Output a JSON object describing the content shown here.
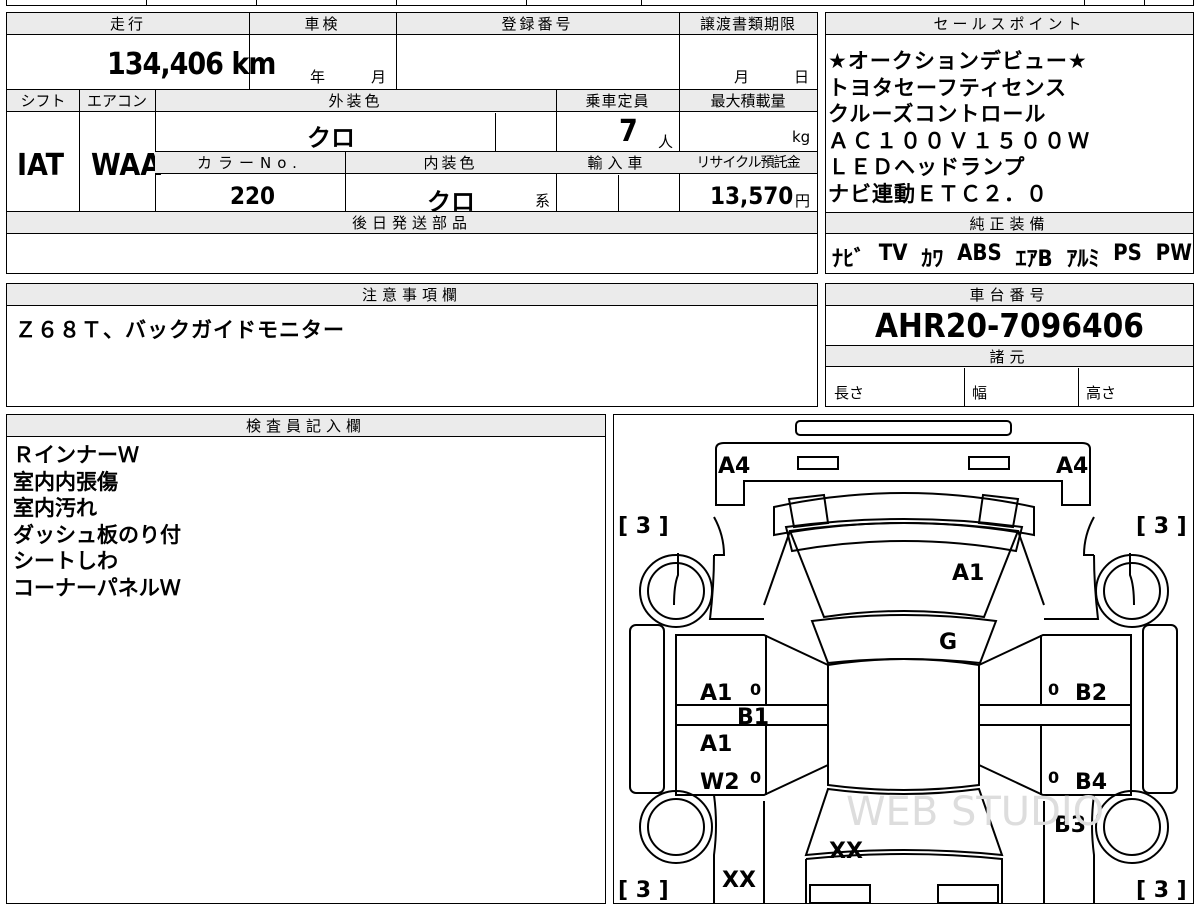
{
  "header_row": {
    "mileage_label": "走行",
    "inspection_label": "車検",
    "registration_label": "登録番号",
    "transfer_deadline_label": "譲渡書類期限",
    "sales_points_label": "セールスポイント"
  },
  "values": {
    "mileage": "134,406 km",
    "inspection_year": "年",
    "inspection_month": "月",
    "transfer_month": "月",
    "transfer_day": "日"
  },
  "row2_labels": {
    "shift": "シフト",
    "aircon": "エアコン",
    "exterior_color": "外装色",
    "capacity": "乗車定員",
    "max_load": "最大積載量"
  },
  "row2_values": {
    "shift": "IAT",
    "aircon": "WAA",
    "exterior_color": "クロ",
    "capacity": "7",
    "capacity_unit": "人",
    "load_unit": "kg"
  },
  "row3_labels": {
    "color_no": "カラーNo.",
    "interior_color": "内装色",
    "import": "輸入車",
    "recycle": "リサイクル預託金"
  },
  "row3_values": {
    "color_no": "220",
    "interior_color": "クロ",
    "interior_suffix": "系",
    "recycle_fee": "13,570",
    "recycle_unit": "円"
  },
  "later_parts_label": "後日発送部品",
  "sales_points": [
    "★オークションデビュー★",
    "トヨタセーフティセンス",
    "クルーズコントロール",
    "ＡＣ１００Ｖ１５００Ｗ",
    "ＬＥＤヘッドランプ",
    "ナビ連動ＥＴＣ２．０"
  ],
  "equipment_label": "純正装備",
  "equipment": [
    "ﾅﾋﾞ",
    "TV",
    "ｶﾜ",
    "ABS",
    "ｴｱB",
    "ｱﾙﾐ",
    "PS",
    "PW"
  ],
  "notes_label": "注意事項欄",
  "notes_text": "Ｚ６８Ｔ、バックガイドモニター",
  "chassis_label": "車台番号",
  "chassis_number": "AHR20-7096406",
  "specs_label": "諸元",
  "specs": {
    "length": "長さ",
    "width": "幅",
    "height": "高さ"
  },
  "inspector_label": "検査員記入欄",
  "inspector_notes": [
    "ＲインナーＷ",
    "室内内張傷",
    "室内汚れ",
    "ダッシュ板のり付",
    "シートしわ",
    "コーナーパネルＷ"
  ],
  "diagram": {
    "tire_marks": [
      "[ 3 ]",
      "[ 3 ]",
      "[ 3 ]",
      "[ 3 ]"
    ],
    "labels": [
      "A4",
      "A4",
      "A1",
      "G",
      "A1",
      "B1",
      "A1",
      "W2",
      "B2",
      "B4",
      "B3",
      "XX",
      "XX"
    ],
    "zero_marks": [
      "0",
      "0",
      "0",
      "0"
    ],
    "watermark": "WEB STUDIO"
  }
}
